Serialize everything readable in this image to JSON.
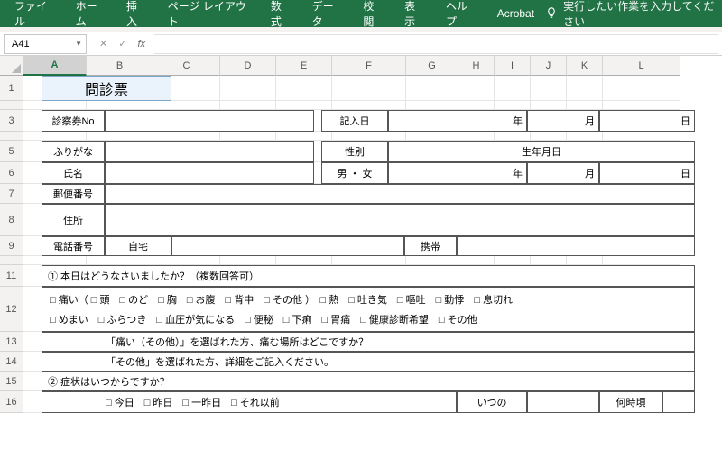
{
  "ribbon": {
    "tabs": [
      "ファイル",
      "ホーム",
      "挿入",
      "ページ レイアウト",
      "数式",
      "データ",
      "校閲",
      "表示",
      "ヘルプ",
      "Acrobat"
    ],
    "tellme": "実行したい作業を入力してください"
  },
  "namebox": {
    "ref": "A41"
  },
  "fx": {
    "label": "fx"
  },
  "columns": [
    "A",
    "B",
    "C",
    "D",
    "E",
    "F",
    "G",
    "H",
    "I",
    "J",
    "K",
    "L"
  ],
  "rows": [
    "1",
    "3",
    "5",
    "6",
    "7",
    "8",
    "9",
    "11",
    "12",
    "13",
    "14",
    "15",
    "16"
  ],
  "sheet": {
    "title": "問診票",
    "r3": {
      "ticket": "診察券No",
      "date": "記入日",
      "year": "年",
      "month": "月",
      "day": "日"
    },
    "r5": {
      "furigana": "ふりがな",
      "sex": "性別",
      "birth": "生年月日"
    },
    "r6": {
      "name": "氏名",
      "sexopt": "男 ・ 女",
      "year": "年",
      "month": "月",
      "day": "日"
    },
    "r7": {
      "postal": "郵便番号"
    },
    "r8": {
      "address": "住所"
    },
    "r9": {
      "tel": "電話番号",
      "home": "自宅",
      "mobile": "携帯"
    },
    "q1": {
      "prompt": "① 本日はどうなさいましたか？（複数回答可）",
      "line1": "□ 痛い（ □ 頭　□ のど　□ 胸　□ お腹　□ 背中　□ その他 ）　□ 熱　□ 吐き気　□ 嘔吐　□ 動悸　□ 息切れ",
      "line2": "□ めまい　□ ふらつき　□ 血圧が気になる　□ 便秘　□ 下痢　□ 胃痛　□ 健康診断希望　□ その他",
      "sub1": "「痛い（その他）」を選ばれた方、痛む場所はどこですか？",
      "sub2": "「その他」を選ばれた方、詳細をご記入ください。"
    },
    "q2": {
      "prompt": "② 症状はいつからですか？",
      "opts": "□ 今日　□ 昨日　□ 一昨日　□ それ以前",
      "when": "いつの",
      "time": "何時頃"
    }
  }
}
